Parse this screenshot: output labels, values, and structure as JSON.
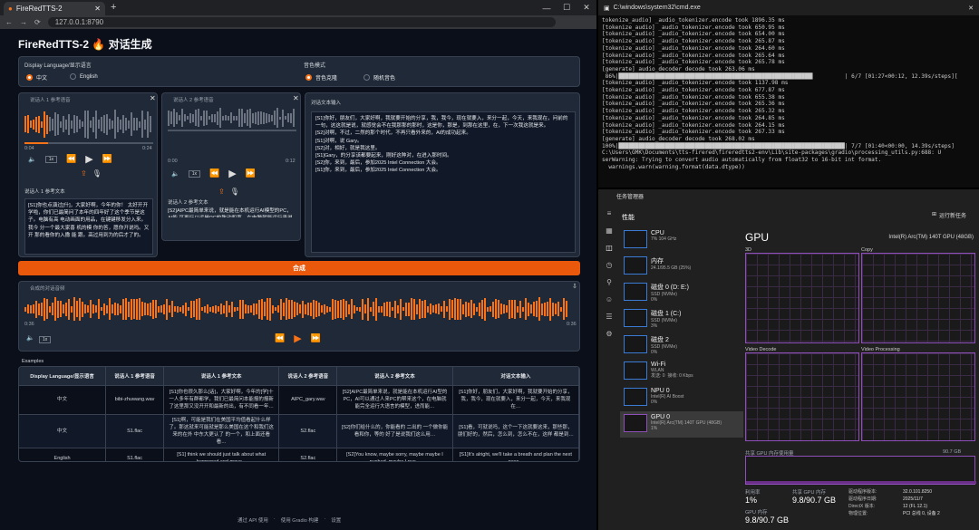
{
  "browser": {
    "tab_title": "FireRedTTS-2",
    "url": "127.0.0.1:8790",
    "app_title": "FireRedTTS-2 🔥 对话生成",
    "display_language": {
      "label": "Display Language/显示语言",
      "options": [
        "中文",
        "English"
      ],
      "selected": "中文"
    },
    "voice_mode": {
      "label": "音色模式",
      "options": [
        "音色克隆",
        "随机音色"
      ],
      "selected": "音色克隆"
    },
    "speaker1": {
      "audio_label": "说话人 1 参考语音",
      "time_start": "0:04",
      "time_end": "0:24",
      "speed": "1x",
      "text_label": "说话人 1 参考文本",
      "text": "[S1]你也点演过[什]，大家好啊，今年的你！ 太好开开学啦，你们已最简问了本年的四年好了这个季节是这子。电脑有高 电动画面的用品，在键键移发分入来。我今 分一个最大家喜 机的模 你的答，愿你开说吗。又开 那的看你的入撒 能 跟。高过用到为的后才了的。"
    },
    "speaker2": {
      "audio_label": "说话人 2 参考语音",
      "time_start": "0:00",
      "time_end": "0:12",
      "speed": "1x",
      "text_label": "说话人 2 参考文本",
      "text": "[S2]AIPC最简单来说，就是能在本机运行AI模型的PC，AI能 可再行以运是PC的致动和声，在电脑就能运行来说出来让这 自组它，进而成本 最本上方案，需要PC的用户体验，释 放了人们的生产力和创造力。而们今天 这个 在正在 的 AIPC的新时代。"
    },
    "dialogue": {
      "label": "对话文本输入",
      "lines": [
        "[S1]你好，朋友们，大家好啊，我就要开始的分享，我，我今，现在就要入，来分一起，今天，来我现在，问前的一句，这这就是说，就感觉会不在我那那的那时，这是你，那是，到那在这里，在，下一次我这就是来。",
        "[S2]对啊，不过，二然的那个时代，不再只看外来的，AI的成功起来。",
        "[S1]对啊，说 Gary。",
        "[S2]对，相好，就是我这里。",
        "[S1]Gary，的分享该都要起来，刚好这种对，在进入那时间。",
        "[S2]你，来到，最后，参加2025 Intel Connection 大会。",
        "[S1]你，来到，最后，参加2025 Intel Connection 大会。"
      ]
    },
    "synthesize_label": "合成",
    "output_label": "合成的对话音频",
    "output_time_start": "0:36",
    "output_time_end": "0:36",
    "output_speed": "1x",
    "examples_label": "Examples",
    "examples": {
      "headers": [
        "Display Language/显示语言",
        "说话人 1 参考语音",
        "说话人 1 参考文本",
        "说话人 2 参考语音",
        "说话人 2 参考文本",
        "对话文本输入"
      ],
      "rows": [
        [
          "中文",
          "bibi-zhuwang.wav",
          "[S1]你也很久那么[话]，大家好啊，今年的[学]十一人多年有群都学，我们已最简问本能报的报新了这里那又没开开和最新的出，有不同看一年…",
          "AIPC_gary.wav",
          "[S2]AIPC最简单来说，就是能在本机运行AI型的PC，AI可以通过人来PC的帮来这个，在电脑就能完全运行大语言的模型，进而能…",
          "[S1]你好，朋友们，大家好啊，我就要开始的分享，我，我今，现在就要入，来分一起，今天，来我现在…"
        ],
        [
          "中文",
          "S1.flac",
          "[S1]啊，可能是我们在美国平均值看起什么样了。那这就来可能就是那么美国在这个和我们这来的在外 中东大更认了 的一个，和上面还看看…",
          "S2.flac",
          "[S2]你们给什么的，你能看的 二出的 一个做你能看和你，等的 好了是说我们这么用…",
          "[S1]看，可就说吗，这个一下这就要这来，那些那，朋们好的，然后，怎么到，怎么不在，这样 都是到…"
        ],
        [
          "English",
          "S1.flac",
          "[S1] think we should just talk about what happened and move...",
          "S2.flac",
          "[S2]You know, maybe sorry, maybe maybe I pushed, maybe I pus...",
          "[S1]It's alright, we'll take a breath and plan the next pass..."
        ]
      ]
    },
    "footer": [
      "通过 API 使用",
      "使用 Gradio 构建",
      "设置"
    ]
  },
  "cmd": {
    "title": "C:\\windows\\system32\\cmd.exe",
    "lines": [
      "tokenize_audio] _audio_tokenizer.encode took 1896.35 ms",
      "[tokenize_audio] _audio_tokenizer.encode took 650.95 ms",
      "[tokenize_audio] _audio_tokenizer.encode took 654.00 ms",
      "[tokenize_audio] _audio_tokenizer.encode took 265.87 ms",
      "[tokenize_audio] _audio_tokenizer.encode took 264.60 ms",
      "[tokenize_audio] _audio_tokenizer.encode took 265.64 ms",
      "[tokenize_audio] _audio_tokenizer.encode took 265.78 ms",
      "[generate] audio_decoder decode took 263.06 ms",
      " 86%|██████████████████████████████████████████████████████████▍         | 6/7 [01:27<00:12, 12.39s/steps][",
      "[tokenize_audio] _audio_tokenizer.encode took 1137.98 ms",
      "[tokenize_audio] _audio_tokenizer.encode took 677.87 ms",
      "[tokenize_audio] _audio_tokenizer.encode took 655.38 ms",
      "[tokenize_audio] _audio_tokenizer.encode took 265.36 ms",
      "[tokenize_audio] _audio_tokenizer.encode took 265.32 ms",
      "[tokenize_audio] _audio_tokenizer.encode took 264.85 ms",
      "[tokenize_audio] _audio_tokenizer.encode took 264.15 ms",
      "[tokenize_audio] _audio_tokenizer.encode took 267.33 ms",
      "[generate] audio_decoder decode took 268.02 ms",
      "100%|████████████████████████████████████████████████████████████████████| 7/7 [01:40<00:00, 14.39s/steps]",
      "C:\\Users\\GMK\\Documents\\tts-firered\\fireredtts2-env\\Lib\\site-packages\\gradio\\processing_utils.py:688: U",
      "serWarning: Trying to convert audio automatically from float32 to 16-bit int format.",
      "  warnings.warn(warning.format(data.dtype))"
    ]
  },
  "taskmgr": {
    "title": "任务管理器",
    "section": "性能",
    "run_task": "运行新任务",
    "sidebar": [
      {
        "name": "CPU",
        "sub": "7% 104 GHz"
      },
      {
        "name": "内存",
        "sub": "24.1/95.5 GB (25%)"
      },
      {
        "name": "磁盘 0 (D: E:)",
        "sub": "SSD (NVMe)\n0%"
      },
      {
        "name": "磁盘 1 (C:)",
        "sub": "SSD (NVMe)\n3%"
      },
      {
        "name": "磁盘 2",
        "sub": "SSD (NVMe)\n0%"
      },
      {
        "name": "Wi-Fi",
        "sub": "WLAN\n发送: 0  接收: 0 Kbps"
      },
      {
        "name": "NPU 0",
        "sub": "Intel(R) AI Boost\n0%"
      },
      {
        "name": "GPU 0",
        "sub": "Intel(R) Arc(TM) 140T GPU (48GB)\n1%"
      }
    ],
    "gpu_title": "GPU",
    "gpu_model": "Intel(R) Arc(TM) 140T GPU (48GB)",
    "graphs": [
      {
        "name": "3D",
        "pct": "0%"
      },
      {
        "name": "Copy",
        "pct": "0%"
      },
      {
        "name": "Video Decode",
        "pct": "0%"
      },
      {
        "name": "Video Processing",
        "pct": "0%"
      }
    ],
    "shared_mem_label": "共享 GPU 内存使用量",
    "shared_mem_max": "90.7 GB",
    "stats": [
      {
        "label": "利用率",
        "value": "1%"
      },
      {
        "label": "共享 GPU 内存",
        "value": "9.8/90.7 GB"
      },
      {
        "label": "GPU 内存",
        "value": "9.8/90.7 GB"
      }
    ],
    "details": [
      {
        "k": "驱动程序版本:",
        "v": "32.0.101.8250"
      },
      {
        "k": "驱动程序日期:",
        "v": "2025/11/7"
      },
      {
        "k": "DirectX 版本:",
        "v": "12 (FL 12.1)"
      },
      {
        "k": "物理位置:",
        "v": "PCI 总线 0, 设备 2"
      }
    ]
  }
}
